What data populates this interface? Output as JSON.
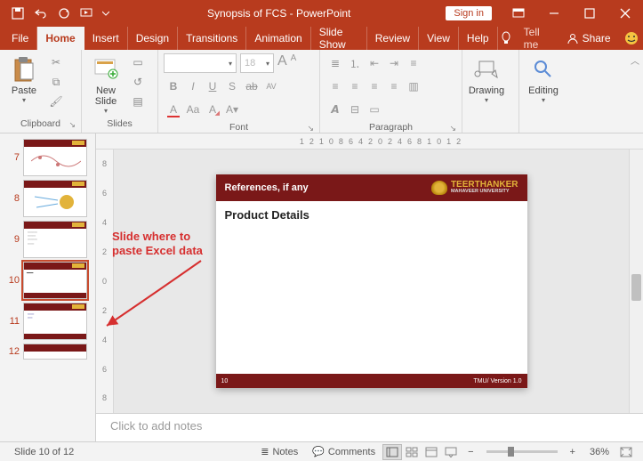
{
  "title": "Synopsis of FCS  -  PowerPoint",
  "signin": "Sign in",
  "tabs": [
    "File",
    "Home",
    "Insert",
    "Design",
    "Transitions",
    "Animation",
    "Slide Show",
    "Review",
    "View",
    "Help"
  ],
  "tellme": "Tell me",
  "share": "Share",
  "ribbon": {
    "clipboard": {
      "label": "Clipboard",
      "paste": "Paste"
    },
    "slides": {
      "label": "Slides",
      "newslide": "New\nSlide"
    },
    "font": {
      "label": "Font",
      "size": "18",
      "fontname": ""
    },
    "paragraph": {
      "label": "Paragraph"
    },
    "drawing": {
      "label": "Drawing",
      "btn": "Drawing"
    },
    "editing": {
      "label": "Editing",
      "btn": "Editing"
    }
  },
  "thumbs": [
    7,
    8,
    9,
    10,
    11,
    12
  ],
  "activeThumb": 10,
  "rulerH": [
    "12",
    "10",
    "8",
    "6",
    "4",
    "2",
    "0",
    "2",
    "4",
    "6",
    "8",
    "10",
    "12"
  ],
  "rulerV": [
    "8",
    "6",
    "4",
    "2",
    "0",
    "2",
    "4",
    "6",
    "8"
  ],
  "slide": {
    "headerTitle": "References, if any",
    "brandMain": "TEERTHANKER",
    "brandSub": "MAHAVEER UNIVERSITY",
    "body": "Product Details",
    "footLeft": "10",
    "footRight": "TMU/ Version 1.0"
  },
  "annotation": "Slide where to\npaste Excel data",
  "notesPlaceholder": "Click to add notes",
  "status": {
    "slide": "Slide 10 of 12",
    "notes": "Notes",
    "comments": "Comments",
    "zoom": "36%"
  }
}
